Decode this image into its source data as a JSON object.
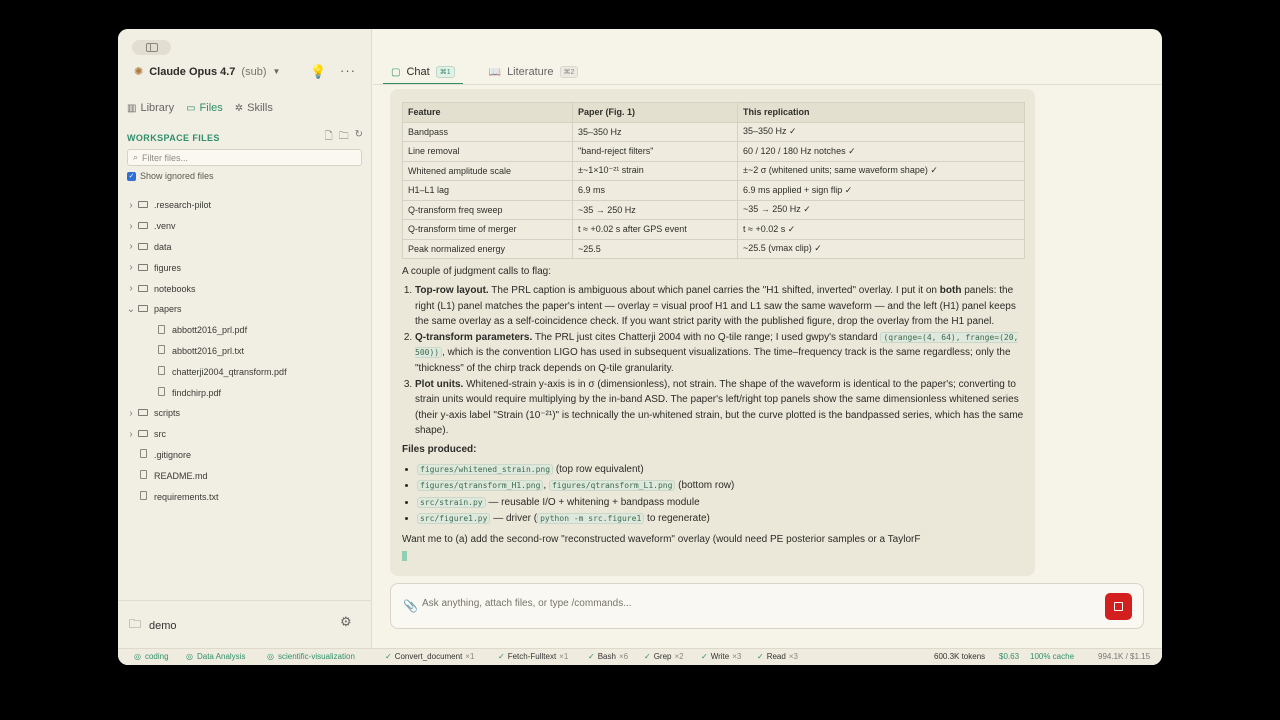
{
  "sidebar": {
    "model_name": "Claude Opus 4.7",
    "model_sub": "(sub)",
    "tabs": [
      {
        "label": "Library",
        "icon": "library-icon"
      },
      {
        "label": "Files",
        "icon": "files-icon"
      },
      {
        "label": "Skills",
        "icon": "skills-icon"
      }
    ],
    "workspace_title": "WORKSPACE FILES",
    "filter_placeholder": "Filter files...",
    "show_ignored_label": "Show ignored files",
    "tree": [
      {
        "name": ".research-pilot",
        "type": "folder",
        "expanded": false,
        "depth": 0
      },
      {
        "name": ".venv",
        "type": "folder",
        "expanded": false,
        "depth": 0
      },
      {
        "name": "data",
        "type": "folder",
        "expanded": false,
        "depth": 0
      },
      {
        "name": "figures",
        "type": "folder",
        "expanded": false,
        "depth": 0
      },
      {
        "name": "notebooks",
        "type": "folder",
        "expanded": false,
        "depth": 0
      },
      {
        "name": "papers",
        "type": "folder",
        "expanded": true,
        "depth": 0
      },
      {
        "name": "abbott2016_prl.pdf",
        "type": "file",
        "depth": 1
      },
      {
        "name": "abbott2016_prl.txt",
        "type": "file",
        "depth": 1
      },
      {
        "name": "chatterji2004_qtransform.pdf",
        "type": "file",
        "depth": 1
      },
      {
        "name": "findchirp.pdf",
        "type": "file",
        "depth": 1
      },
      {
        "name": "scripts",
        "type": "folder",
        "expanded": false,
        "depth": 0
      },
      {
        "name": "src",
        "type": "folder",
        "expanded": false,
        "depth": 0
      },
      {
        "name": ".gitignore",
        "type": "file",
        "depth": 0
      },
      {
        "name": "README.md",
        "type": "file",
        "depth": 0
      },
      {
        "name": "requirements.txt",
        "type": "file",
        "depth": 0
      }
    ],
    "project_name": "demo"
  },
  "main": {
    "tabs": [
      {
        "label": "Chat",
        "shortcut": "⌘1"
      },
      {
        "label": "Literature",
        "shortcut": "⌘2"
      }
    ],
    "table": {
      "headers": [
        "Feature",
        "Paper (Fig. 1)",
        "This replication"
      ],
      "rows": [
        [
          "Bandpass",
          "35–350 Hz",
          "35–350 Hz ✓"
        ],
        [
          "Line removal",
          "\"band-reject filters\"",
          "60 / 120 / 180 Hz notches ✓"
        ],
        [
          "Whitened amplitude scale",
          "±~1×10⁻²¹ strain",
          "±~2 σ (whitened units; same waveform shape) ✓"
        ],
        [
          "H1–L1 lag",
          "6.9 ms",
          "6.9 ms applied + sign flip ✓"
        ],
        [
          "Q-transform freq sweep",
          "~35 → 250 Hz",
          "~35 → 250 Hz ✓"
        ],
        [
          "Q-transform time of merger",
          "t ≈ +0.02 s after GPS event",
          "t ≈ +0.02 s ✓"
        ],
        [
          "Peak normalized energy",
          "~25.5",
          "~25.5 (vmax clip) ✓"
        ]
      ]
    },
    "intro": "A couple of judgment calls to flag:",
    "items": {
      "i1_title": "Top-row layout.",
      "i1_a": " The PRL caption is ambiguous about which panel carries the \"H1 shifted, inverted\" overlay. I put it on ",
      "i1_bold": "both",
      "i1_b": " panels: the right (L1) panel matches the paper's intent — overlay = visual proof H1 and L1 saw the same waveform — and the left (H1) panel keeps the same overlay as a self-coincidence check. If you want strict parity with the published figure, drop the overlay from the H1 panel.",
      "i2_title": "Q-transform parameters.",
      "i2_a": " The PRL just cites Chatterji 2004 with no Q-tile range; I used gwpy's standard ",
      "i2_code": "(qrange=(4, 64), frange=(20, 500))",
      "i2_b": ", which is the convention LIGO has used in subsequent visualizations. The time–frequency track is the same regardless; only the \"thickness\" of the chirp track depends on Q-tile granularity.",
      "i3_title": "Plot units.",
      "i3_text": " Whitened-strain y-axis is in σ (dimensionless), not strain. The shape of the waveform is identical to the paper's; converting to strain units would require multiplying by the in-band ASD. The paper's left/right top panels show the same dimensionless whitened series (their y-axis label \"Strain (10⁻²¹)\" is technically the un-whitened strain, but the curve plotted is the bandpassed series, which has the same shape)."
    },
    "files_heading": "Files produced:",
    "files": {
      "f1_code": "figures/whitened_strain.png",
      "f1_text": " (top row equivalent)",
      "f2_code_a": "figures/qtransform_H1.png",
      "f2_sep": ", ",
      "f2_code_b": "figures/qtransform_L1.png",
      "f2_text": " (bottom row)",
      "f3_code": "src/strain.py",
      "f3_text": " — reusable I/O + whitening + bandpass module",
      "f4_code": "src/figure1.py",
      "f4_text_a": " — driver (",
      "f4_code_b": "python -m src.figure1",
      "f4_text_b": " to regenerate)"
    },
    "closing": "Want me to (a) add the second-row \"reconstructed waveform\" overlay (would need PE posterior samples or a TaylorF",
    "composer_placeholder": "Ask anything, attach files, or type /commands..."
  },
  "statusbar": {
    "skills": [
      "coding",
      "Data Analysis",
      "scientific-visualization"
    ],
    "tools": [
      {
        "name": "Convert_document",
        "count": "×1"
      },
      {
        "name": "Fetch-Fulltext",
        "count": "×1"
      },
      {
        "name": "Bash",
        "count": "×6"
      },
      {
        "name": "Grep",
        "count": "×2"
      },
      {
        "name": "Write",
        "count": "×3"
      },
      {
        "name": "Read",
        "count": "×3"
      }
    ],
    "tokens": "600.3K tokens",
    "cost": "$0.63",
    "cache": "100% cache",
    "total": "994.1K / $1.15"
  },
  "colors": {
    "accent": "#2f8f6d",
    "stop": "#d41f1f",
    "background": "#f6f3e9"
  }
}
